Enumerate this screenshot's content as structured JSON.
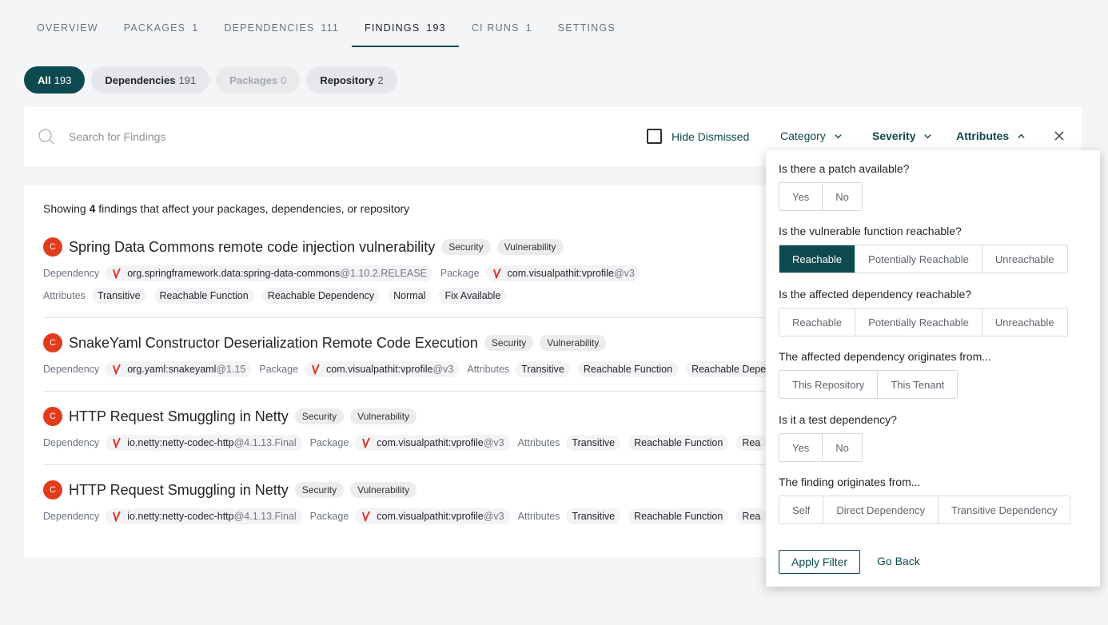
{
  "tabs": [
    {
      "label": "OVERVIEW",
      "count": ""
    },
    {
      "label": "PACKAGES",
      "count": "1"
    },
    {
      "label": "DEPENDENCIES",
      "count": "111"
    },
    {
      "label": "FINDINGS",
      "count": "193"
    },
    {
      "label": "CI RUNS",
      "count": "1"
    },
    {
      "label": "SETTINGS",
      "count": ""
    }
  ],
  "pills": [
    {
      "label": "All",
      "count": "193"
    },
    {
      "label": "Dependencies",
      "count": "191"
    },
    {
      "label": "Packages",
      "count": "0"
    },
    {
      "label": "Repository",
      "count": "2"
    }
  ],
  "search": {
    "placeholder": "Search for Findings",
    "value": "",
    "hide_dismissed": "Hide Dismissed",
    "category": "Category",
    "severity": "Severity",
    "attributes": "Attributes"
  },
  "summary": {
    "prefix": "Showing",
    "count": "4",
    "suffix": "findings that affect your packages, dependencies, or repository"
  },
  "labels": {
    "dependency": "Dependency",
    "package": "Package",
    "attributes": "Attributes",
    "severity_letter": "C"
  },
  "findings": [
    {
      "title": "Spring Data Commons remote code injection vulnerability",
      "tags": [
        "Security",
        "Vulnerability"
      ],
      "dependency": "org.springframework.data:spring-data-commons",
      "dependency_version": "@1.10.2.RELEASE",
      "package": "com.visualpathit:vprofile",
      "package_version": "@v3",
      "attributes": [
        "Transitive",
        "Reachable Function",
        "Reachable Dependency",
        "Normal",
        "Fix Available"
      ]
    },
    {
      "title": "SnakeYaml Constructor Deserialization Remote Code Execution",
      "tags": [
        "Security",
        "Vulnerability"
      ],
      "dependency": "org.yaml:snakeyaml",
      "dependency_version": "@1.15",
      "package": "com.visualpathit:vprofile",
      "package_version": "@v3",
      "attributes": [
        "Transitive",
        "Reachable Function",
        "Reachable Depe"
      ]
    },
    {
      "title": "HTTP Request Smuggling in Netty",
      "tags": [
        "Security",
        "Vulnerability"
      ],
      "dependency": "io.netty:netty-codec-http",
      "dependency_version": "@4.1.13.Final",
      "package": "com.visualpathit:vprofile",
      "package_version": "@v3",
      "attributes": [
        "Transitive",
        "Reachable Function",
        "Rea"
      ]
    },
    {
      "title": "HTTP Request Smuggling in Netty",
      "tags": [
        "Security",
        "Vulnerability"
      ],
      "dependency": "io.netty:netty-codec-http",
      "dependency_version": "@4.1.13.Final",
      "package": "com.visualpathit:vprofile",
      "package_version": "@v3",
      "attributes": [
        "Transitive",
        "Reachable Function",
        "Rea"
      ]
    }
  ],
  "popup": {
    "questions": [
      {
        "text": "Is there a patch available?",
        "options": [
          "Yes",
          "No"
        ],
        "selected": ""
      },
      {
        "text": "Is the vulnerable function reachable?",
        "options": [
          "Reachable",
          "Potentially Reachable",
          "Unreachable"
        ],
        "selected": "Reachable"
      },
      {
        "text": "Is the affected dependency reachable?",
        "options": [
          "Reachable",
          "Potentially Reachable",
          "Unreachable"
        ],
        "selected": ""
      },
      {
        "text": "The affected dependency originates from...",
        "options": [
          "This Repository",
          "This Tenant"
        ],
        "selected": ""
      },
      {
        "text": "Is it a test dependency?",
        "options": [
          "Yes",
          "No"
        ],
        "selected": ""
      },
      {
        "text": "The finding originates from...",
        "options": [
          "Self",
          "Direct Dependency",
          "Transitive Dependency"
        ],
        "selected": ""
      }
    ],
    "apply": "Apply Filter",
    "go_back": "Go Back"
  },
  "colors": {
    "accent": "#0d4a4f",
    "critical": "#e23b1c"
  }
}
